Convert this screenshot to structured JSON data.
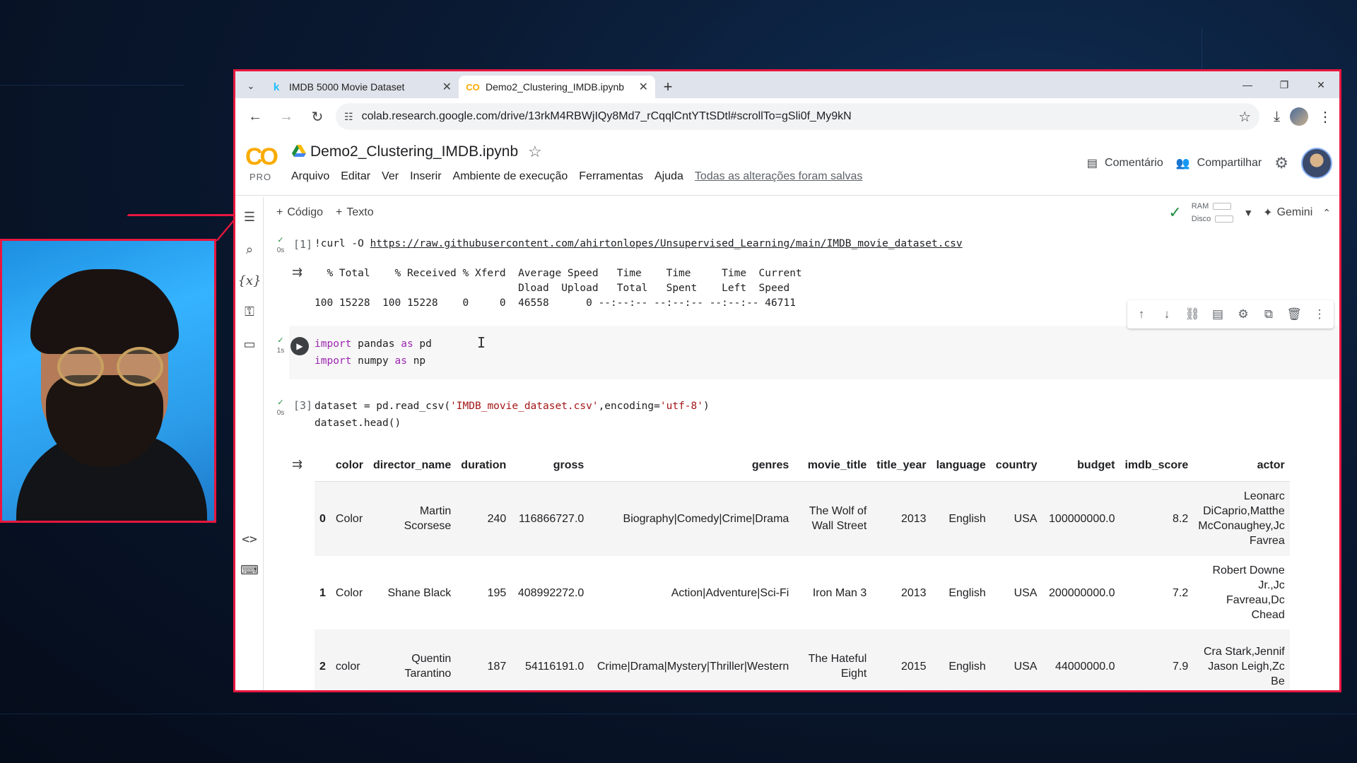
{
  "browser": {
    "tabs": [
      {
        "icon": "kaggle-icon",
        "glyph": "k",
        "label": "IMDB 5000 Movie Dataset",
        "active": false
      },
      {
        "icon": "colab-icon",
        "glyph": "CO",
        "label": "Demo2_Clustering_IMDB.ipynb",
        "active": true
      }
    ],
    "url": "colab.research.google.com/drive/13rkM4RBWjIQy8Md7_rCqqlCntYTtSDtl#scrollTo=gSli0f_My9kN"
  },
  "colab": {
    "logo": "CO",
    "pro": "PRO",
    "notebook_title": "Demo2_Clustering_IMDB.ipynb",
    "menu": [
      "Arquivo",
      "Editar",
      "Ver",
      "Inserir",
      "Ambiente de execução",
      "Ferramentas",
      "Ajuda"
    ],
    "saved_status": "Todas as alterações foram salvas",
    "comment_label": "Comentário",
    "share_label": "Compartilhar",
    "toolbar": {
      "code_label": "Código",
      "text_label": "Texto"
    },
    "resources": {
      "ram": "RAM",
      "disk": "Disco"
    },
    "gemini_label": "Gemini"
  },
  "cells": {
    "c1": {
      "count": "[1]",
      "time": "0s",
      "code_prefix": "!curl -O ",
      "code_link": "https://raw.githubusercontent.com/ahirtonlopes/Unsupervised_Learning/main/IMDB_movie_dataset.csv",
      "output": "  % Total    % Received % Xferd  Average Speed   Time    Time     Time  Current\n                                 Dload  Upload   Total   Spent    Left  Speed\n100 15228  100 15228    0     0  46558      0 --:--:-- --:--:-- --:--:-- 46711"
    },
    "c2": {
      "time": "1s",
      "line1": [
        "import",
        " pandas ",
        "as",
        " pd"
      ],
      "line2": [
        "import",
        " numpy ",
        "as",
        " np"
      ]
    },
    "c3": {
      "count": "[3]",
      "time": "0s",
      "line1_a": "dataset = pd.read_csv(",
      "line1_s1": "'IMDB_movie_dataset.csv'",
      "line1_b": ",encoding=",
      "line1_s2": "'utf-8'",
      "line1_c": ")",
      "line2": "dataset.head()"
    }
  },
  "dataframe": {
    "columns": [
      "",
      "color",
      "director_name",
      "duration",
      "gross",
      "genres",
      "movie_title",
      "title_year",
      "language",
      "country",
      "budget",
      "imdb_score",
      "actor"
    ],
    "rows": [
      [
        "0",
        "Color",
        "Martin Scorsese",
        "240",
        "116866727.0",
        "Biography|Comedy|Crime|Drama",
        "The Wolf of Wall Street",
        "2013",
        "English",
        "USA",
        "100000000.0",
        "8.2",
        "Leonarc DiCaprio,Matthe McConaughey,Jc Favrea"
      ],
      [
        "1",
        "Color",
        "Shane Black",
        "195",
        "408992272.0",
        "Action|Adventure|Sci-Fi",
        "Iron Man 3",
        "2013",
        "English",
        "USA",
        "200000000.0",
        "7.2",
        "Robert Downe Jr.,Jc Favreau,Dc Chead"
      ],
      [
        "2",
        "color",
        "Quentin Tarantino",
        "187",
        "54116191.0",
        "Crime|Drama|Mystery|Thriller|Western",
        "The Hateful Eight",
        "2015",
        "English",
        "USA",
        "44000000.0",
        "7.9",
        "Cra Stark,Jennif Jason Leigh,Zc Be"
      ]
    ]
  },
  "colors": {
    "frame": "#e8173f",
    "colab_orange": "#f9ab00",
    "success": "#1e8e3e"
  }
}
